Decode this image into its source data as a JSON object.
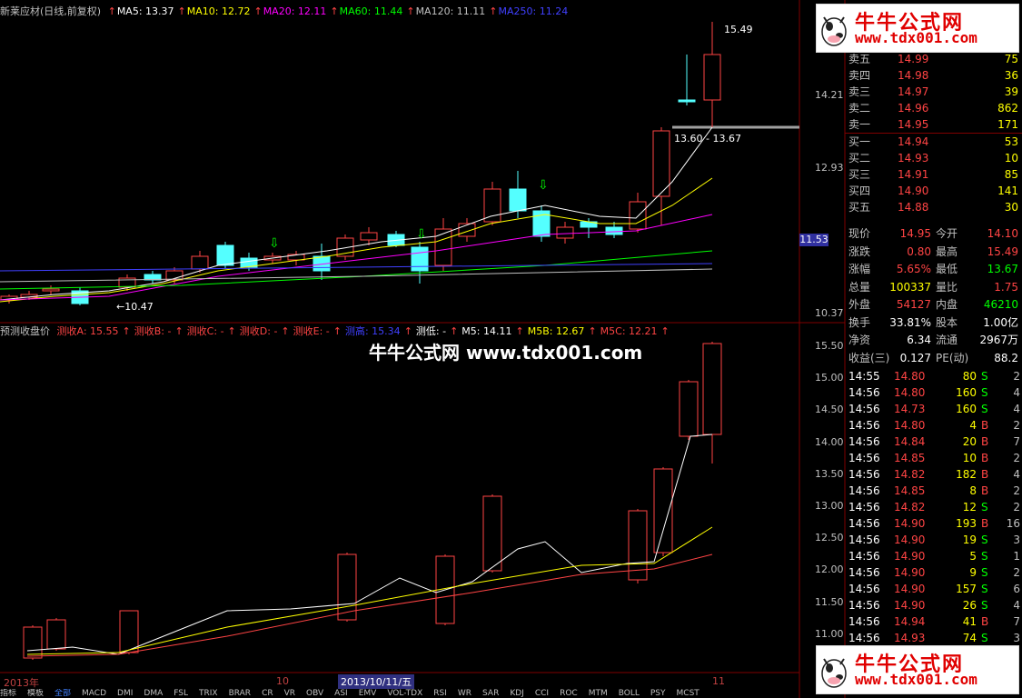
{
  "header": {
    "stock_name": "新莱应材(日线,前复权)",
    "items": [
      {
        "label": "MA5: 13.37",
        "color": "#ffffff"
      },
      {
        "label": "MA10: 12.72",
        "color": "#ffff00"
      },
      {
        "label": "MA20: 12.11",
        "color": "#ff00ff"
      },
      {
        "label": "MA60: 11.44",
        "color": "#00ff00"
      },
      {
        "label": "MA120: 11.11",
        "color": "#c0c0c0"
      },
      {
        "label": "MA250: 11.24",
        "color": "#4040ff"
      }
    ]
  },
  "upper_chart": {
    "high_label": "15.49",
    "low_label": "10.47",
    "range_label": "13.60 - 13.67",
    "price_ticks": [
      "14.21",
      "12.93",
      "11.53",
      "10.37"
    ],
    "current_price_marker": "11.53"
  },
  "lower_header": {
    "title": "预测收盘价",
    "items": [
      {
        "label": "测收A: 15.55",
        "color": "#ff4444"
      },
      {
        "label": "测收B: -",
        "color": "#ff4444"
      },
      {
        "label": "测收C: -",
        "color": "#ff4444"
      },
      {
        "label": "测收D: -",
        "color": "#ff4444"
      },
      {
        "label": "测收E: -",
        "color": "#ff4444"
      },
      {
        "label": "测高: 15.34",
        "color": "#4040ff"
      },
      {
        "label": "测低: -",
        "color": "#ffffff"
      },
      {
        "label": "M5: 14.11",
        "color": "#ffffff"
      },
      {
        "label": "M5B: 12.67",
        "color": "#ffff00"
      },
      {
        "label": "M5C: 12.21",
        "color": "#ff4444"
      }
    ]
  },
  "lower_chart": {
    "price_ticks": [
      "15.50",
      "15.00",
      "14.50",
      "14.00",
      "13.50",
      "13.00",
      "12.50",
      "12.00",
      "11.50",
      "11.00"
    ]
  },
  "watermark_center": "牛牛公式网 www.tdx001.com",
  "brand": {
    "name": "牛牛公式网",
    "url": "www.tdx001.com"
  },
  "x_axis": {
    "labels": [
      "2013年",
      "10",
      "2013/10/11/五",
      "11"
    ]
  },
  "bottom_tabs": [
    "指标",
    "模板",
    "全部",
    "MACD",
    "DMI",
    "DMA",
    "FSL",
    "TRIX",
    "BRAR",
    "CR",
    "VR",
    "OBV",
    "ASI",
    "EMV",
    "VOL-TDX",
    "RSI",
    "WR",
    "SAR",
    "KDJ",
    "CCI",
    "ROC",
    "MTM",
    "BOLL",
    "PSY",
    "MCST"
  ],
  "order_book": {
    "asks": [
      {
        "label": "卖五",
        "price": "14.99",
        "vol": "75"
      },
      {
        "label": "卖四",
        "price": "14.98",
        "vol": "36"
      },
      {
        "label": "卖三",
        "price": "14.97",
        "vol": "39"
      },
      {
        "label": "卖二",
        "price": "14.96",
        "vol": "862"
      },
      {
        "label": "卖一",
        "price": "14.95",
        "vol": "171"
      }
    ],
    "bids": [
      {
        "label": "买一",
        "price": "14.94",
        "vol": "53"
      },
      {
        "label": "买二",
        "price": "14.93",
        "vol": "10"
      },
      {
        "label": "买三",
        "price": "14.91",
        "vol": "85"
      },
      {
        "label": "买四",
        "price": "14.90",
        "vol": "141"
      },
      {
        "label": "买五",
        "price": "14.88",
        "vol": "30"
      }
    ]
  },
  "quote": [
    {
      "l1": "现价",
      "v1": "14.95",
      "c1": "#ff4444",
      "l2": "今开",
      "v2": "14.10",
      "c2": "#ff4444"
    },
    {
      "l1": "涨跌",
      "v1": "0.80",
      "c1": "#ff4444",
      "l2": "最高",
      "v2": "15.49",
      "c2": "#ff4444"
    },
    {
      "l1": "涨幅",
      "v1": "5.65%",
      "c1": "#ff4444",
      "l2": "最低",
      "v2": "13.67",
      "c2": "#00ff00"
    },
    {
      "l1": "总量",
      "v1": "100337",
      "c1": "#ffff00",
      "l2": "量比",
      "v2": "1.75",
      "c2": "#ff4444"
    },
    {
      "l1": "外盘",
      "v1": "54127",
      "c1": "#ff4444",
      "l2": "内盘",
      "v2": "46210",
      "c2": "#00ff00"
    },
    {
      "l1": "换手",
      "v1": "33.81%",
      "c1": "#ffffff",
      "l2": "股本",
      "v2": "1.00亿",
      "c2": "#ffffff"
    },
    {
      "l1": "净资",
      "v1": "6.34",
      "c1": "#ffffff",
      "l2": "流通",
      "v2": "2967万",
      "c2": "#ffffff"
    },
    {
      "l1": "收益(三)",
      "v1": "0.127",
      "c1": "#ffffff",
      "l2": "PE(动)",
      "v2": "88.2",
      "c2": "#ffffff"
    }
  ],
  "ticks": [
    {
      "time": "14:55",
      "price": "14.80",
      "vol": "80",
      "side": "S",
      "n": "2"
    },
    {
      "time": "14:56",
      "price": "14.80",
      "vol": "160",
      "side": "S",
      "n": "4"
    },
    {
      "time": "14:56",
      "price": "14.73",
      "vol": "160",
      "side": "S",
      "n": "4"
    },
    {
      "time": "14:56",
      "price": "14.80",
      "vol": "4",
      "side": "B",
      "n": "2"
    },
    {
      "time": "14:56",
      "price": "14.84",
      "vol": "20",
      "side": "B",
      "n": "7"
    },
    {
      "time": "14:56",
      "price": "14.85",
      "vol": "10",
      "side": "B",
      "n": "2"
    },
    {
      "time": "14:56",
      "price": "14.82",
      "vol": "182",
      "side": "B",
      "n": "4"
    },
    {
      "time": "14:56",
      "price": "14.85",
      "vol": "8",
      "side": "B",
      "n": "2"
    },
    {
      "time": "14:56",
      "price": "14.82",
      "vol": "12",
      "side": "S",
      "n": "2"
    },
    {
      "time": "14:56",
      "price": "14.90",
      "vol": "193",
      "side": "B",
      "n": "16"
    },
    {
      "time": "14:56",
      "price": "14.90",
      "vol": "19",
      "side": "S",
      "n": "3"
    },
    {
      "time": "14:56",
      "price": "14.90",
      "vol": "5",
      "side": "S",
      "n": "1"
    },
    {
      "time": "14:56",
      "price": "14.90",
      "vol": "9",
      "side": "S",
      "n": "2"
    },
    {
      "time": "14:56",
      "price": "14.90",
      "vol": "157",
      "side": "S",
      "n": "6"
    },
    {
      "time": "14:56",
      "price": "14.90",
      "vol": "26",
      "side": "S",
      "n": "4"
    },
    {
      "time": "14:56",
      "price": "14.94",
      "vol": "41",
      "side": "B",
      "n": "7"
    },
    {
      "time": "14:56",
      "price": "14.93",
      "vol": "74",
      "side": "S",
      "n": "3"
    }
  ],
  "colors": {
    "up": "#ff4444",
    "down": "#54ffff",
    "sell": "#00ff00",
    "buy": "#ff4444"
  }
}
